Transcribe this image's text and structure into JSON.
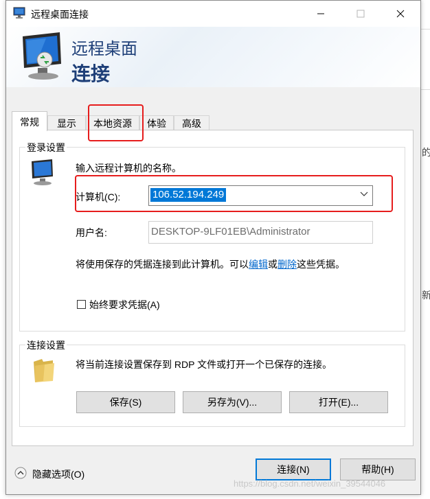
{
  "window": {
    "title": "远程桌面连接"
  },
  "header": {
    "line1": "远程桌面",
    "line2": "连接"
  },
  "tabs": [
    {
      "label": "常规"
    },
    {
      "label": "显示"
    },
    {
      "label": "本地资源"
    },
    {
      "label": "体验"
    },
    {
      "label": "高级"
    }
  ],
  "login": {
    "group_title": "登录设置",
    "prompt": "输入远程计算机的名称。",
    "computer_label": "计算机(C):",
    "computer_value": "106.52.194.249",
    "username_label": "用户名:",
    "username_value": "DESKTOP-9LF01EB\\Administrator",
    "creds_pre": "将使用保存的凭据连接到此计算机。可以",
    "creds_edit": "编辑",
    "creds_or": "或",
    "creds_delete": "删除",
    "creds_post": "这些凭据。",
    "always_ask": "始终要求凭据(A)"
  },
  "connection": {
    "group_title": "连接设置",
    "description": "将当前连接设置保存到 RDP 文件或打开一个已保存的连接。",
    "save": "保存(S)",
    "save_as": "另存为(V)...",
    "open": "打开(E)..."
  },
  "footer": {
    "hide_options": "隐藏选项(O)",
    "connect": "连接(N)",
    "help": "帮助(H)"
  },
  "watermark": "https://blog.csdn.net/weixin_39544046",
  "background_glyphs": [
    "的",
    "新"
  ],
  "colors": {
    "selection": "#0078d7",
    "link": "#0066cc",
    "highlight_box": "#e61c1c",
    "header_text": "#1e3f78"
  }
}
